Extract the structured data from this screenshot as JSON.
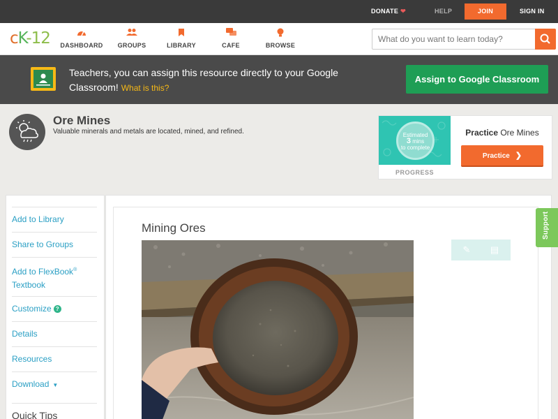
{
  "topbar": {
    "donate": "DONATE",
    "help": "HELP",
    "join": "JOIN",
    "sign_in": "SIGN IN"
  },
  "nav": {
    "logo": {
      "c": "c",
      "k": "K",
      "n": "-12"
    },
    "items": [
      {
        "label": "DASHBOARD",
        "icon": "dashboard-icon"
      },
      {
        "label": "GROUPS",
        "icon": "groups-icon"
      },
      {
        "label": "LIBRARY",
        "icon": "library-icon"
      },
      {
        "label": "CAFE",
        "icon": "cafe-icon"
      },
      {
        "label": "BROWSE",
        "icon": "browse-icon"
      }
    ],
    "search_placeholder": "What do you want to learn today?"
  },
  "banner": {
    "message": "Teachers, you can assign this resource directly to your Google Classroom!",
    "what_link": "What is this?",
    "assign_button": "Assign to Google Classroom"
  },
  "concept": {
    "title": "Ore Mines",
    "description": "Valuable minerals and metals are located, mined, and refined.",
    "icon": "weather-cloud-icon"
  },
  "practice": {
    "estimated_label": "Estimated",
    "minutes": "3",
    "mins_label": "mins",
    "to_complete": "to complete",
    "progress_label": "PROGRESS",
    "title_bold": "Practice",
    "title_rest": "Ore Mines",
    "button": "Practice"
  },
  "sidebar": {
    "add_library": "Add to Library",
    "share_groups": "Share to Groups",
    "add_flexbook_1": "Add to FlexBook",
    "add_flexbook_tm": "®",
    "add_flexbook_2": "Textbook",
    "customize": "Customize",
    "customize_badge": "?",
    "details": "Details",
    "resources": "Resources",
    "download": "Download",
    "quick_tips": "Quick Tips"
  },
  "main": {
    "section_title": "Mining Ores"
  },
  "support": "Support",
  "colors": {
    "accent": "#f26a2e",
    "classroom_green": "#1e9e55",
    "link_blue": "#2a9fc4",
    "support_green": "#7cc85b",
    "teal": "#2fc4b2"
  }
}
